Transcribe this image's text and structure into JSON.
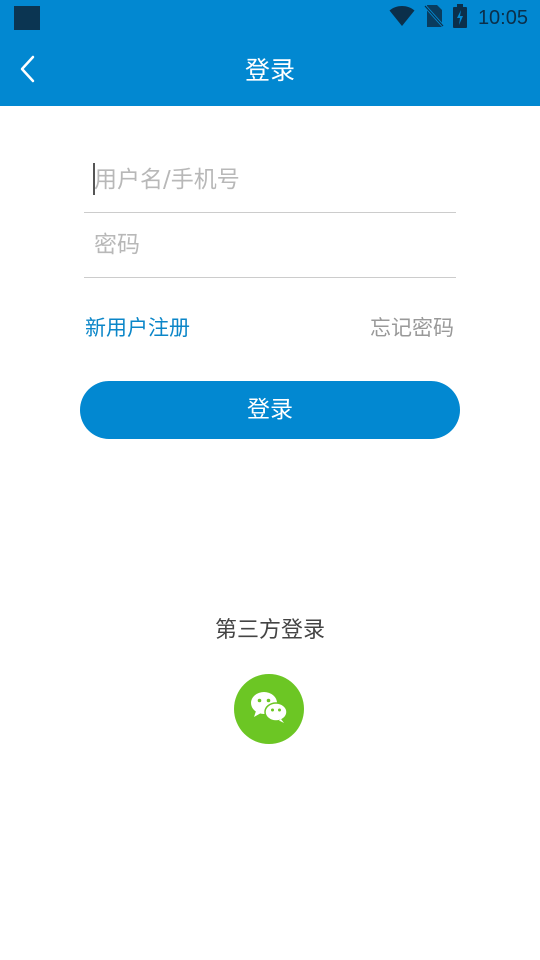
{
  "status_bar": {
    "time": "10:05",
    "icons": [
      "notification-square-icon",
      "wifi-icon",
      "no-sim-icon",
      "battery-charging-icon"
    ]
  },
  "toolbar": {
    "back_icon": "chevron-left-icon",
    "title": "登录"
  },
  "form": {
    "username_placeholder": "用户名/手机号",
    "username_value": "",
    "password_placeholder": "密码",
    "password_value": ""
  },
  "links": {
    "register": "新用户注册",
    "forgot_password": "忘记密码"
  },
  "login_button": "登录",
  "third_party": {
    "title": "第三方登录",
    "providers": [
      {
        "icon": "wechat-icon",
        "color": "#6cc624"
      }
    ]
  },
  "colors": {
    "primary": "#0288d1",
    "link": "#0b86c8",
    "muted": "#999999"
  }
}
